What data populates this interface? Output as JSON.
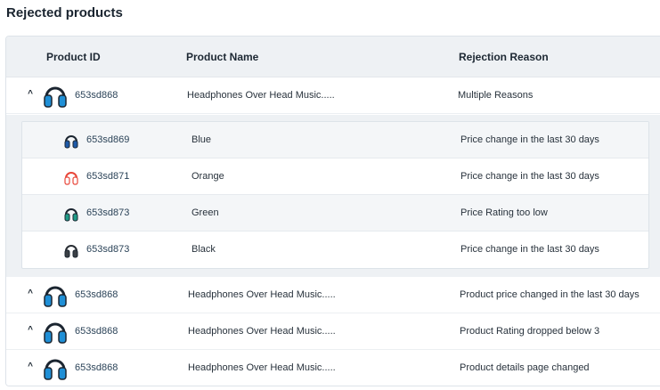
{
  "page": {
    "title": "Rejected products"
  },
  "table": {
    "columns": [
      "Product ID",
      "Product Name",
      "Rejection Reason"
    ],
    "rows": [
      {
        "id": "653sd868",
        "name": "Headphones Over Head Music.....",
        "reason": "Multiple Reasons",
        "icon": "headphones-blue-icon",
        "expanded": true
      },
      {
        "id": "653sd868",
        "name": "Headphones Over Head Music.....",
        "reason": "Product price changed in the last 30 days",
        "icon": "headphones-blue-icon",
        "expanded": false
      },
      {
        "id": "653sd868",
        "name": "Headphones Over Head Music.....",
        "reason": "Product Rating dropped below 3",
        "icon": "headphones-blue-icon",
        "expanded": false
      },
      {
        "id": "653sd868",
        "name": "Headphones Over Head Music.....",
        "reason": "Product details page changed",
        "icon": "headphones-blue-icon",
        "expanded": false
      }
    ],
    "variants": [
      {
        "id": "653sd869",
        "name": "Blue",
        "reason": "Price change in the last 30 days",
        "icon": "headphones-blue-icon",
        "color": "#1e5aa8"
      },
      {
        "id": "653sd871",
        "name": "Orange",
        "reason": "Price change in the last 30 days",
        "icon": "headphones-orange-icon",
        "color": "#e8473a"
      },
      {
        "id": "653sd873",
        "name": "Green",
        "reason": "Price Rating too low",
        "icon": "headphones-green-icon",
        "color": "#1f9a86"
      },
      {
        "id": "653sd873",
        "name": "Black",
        "reason": "Price change in the last 30 days",
        "icon": "headphones-black-icon",
        "color": "#2a2f35"
      }
    ]
  },
  "colors": {
    "header_bg": "#eef1f4",
    "border": "#dde3e9",
    "headphone_blue": "#1f8fd6",
    "headphone_dark": "#1b2530"
  }
}
